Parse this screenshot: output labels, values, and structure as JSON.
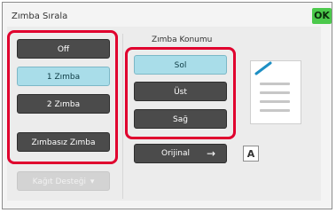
{
  "header": {
    "title": "Zımba Sırala",
    "ok_label": "OK"
  },
  "left": {
    "buttons": [
      "Off",
      "1 Zımba",
      "2 Zımba",
      "Zımbasız Zımba"
    ],
    "selected_index": 1,
    "disabled_label": "Kağıt Desteği"
  },
  "right": {
    "section_title": "Zımba Konumu",
    "positions": [
      "Sol",
      "Üst",
      "Sağ"
    ],
    "selected_index": 0,
    "orientation_label": "Orijinal",
    "orientation_letter": "A"
  },
  "colors": {
    "accent": "#a9dde9",
    "highlight_border": "#e0002e",
    "ok": "#4cc94c"
  }
}
